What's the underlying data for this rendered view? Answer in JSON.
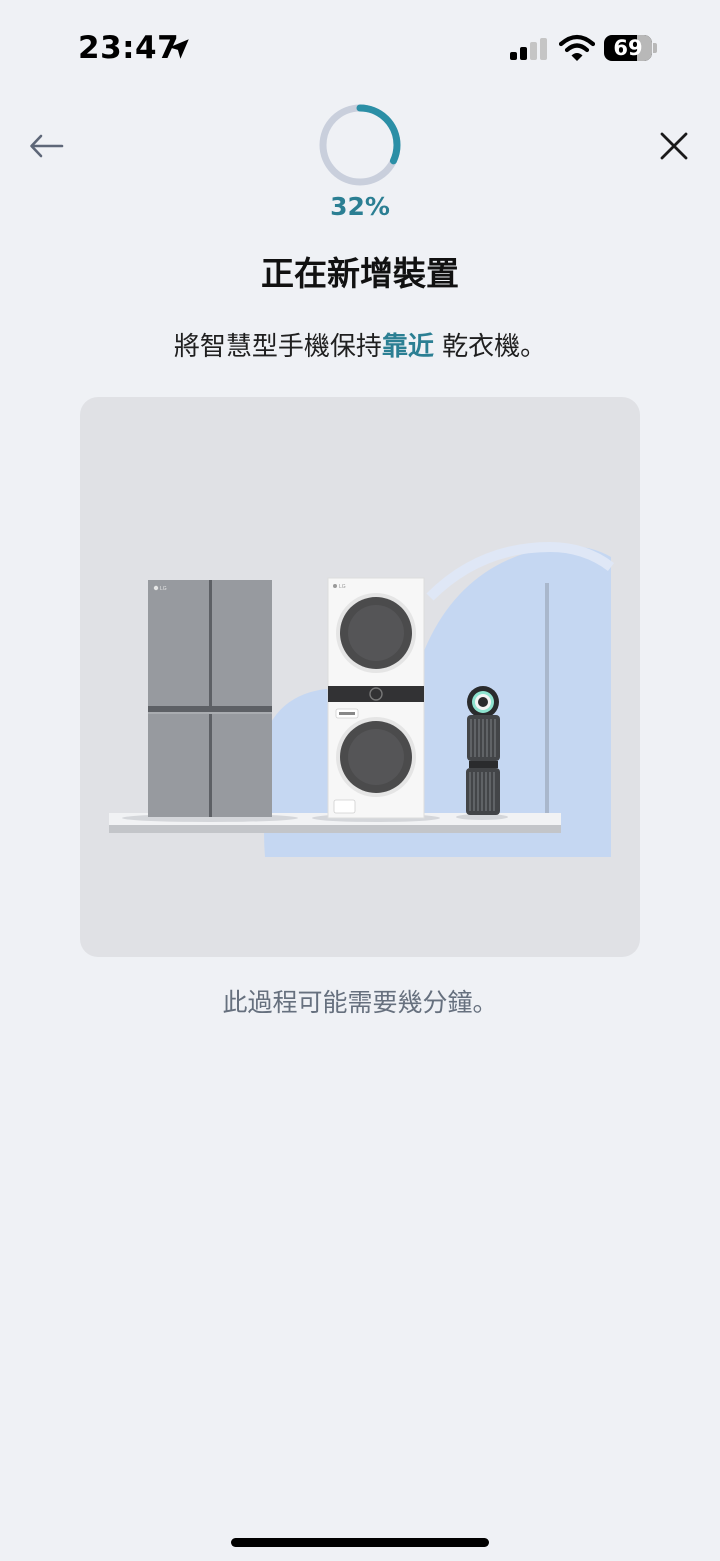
{
  "status_bar": {
    "time": "23:47",
    "battery_level": "69",
    "battery_fraction": 0.69
  },
  "header": {
    "back_icon": "arrow-left-icon",
    "close_icon": "close-icon"
  },
  "progress": {
    "value": 0.32,
    "label": "32%",
    "color": "#2b7f93",
    "track_color": "#c9cfdc"
  },
  "title": "正在新增裝置",
  "instruction": {
    "before": "將智慧型手機保持",
    "highlight": "靠近",
    "after": " 乾衣機。"
  },
  "illustration": {
    "appliances": [
      "refrigerator",
      "washer-dryer-tower",
      "air-purifier"
    ],
    "brand_mark": "LG"
  },
  "note": "此過程可能需要幾分鐘。",
  "colors": {
    "background": "#eff1f5",
    "accent": "#2b7f93",
    "card": "#e0e1e5"
  }
}
